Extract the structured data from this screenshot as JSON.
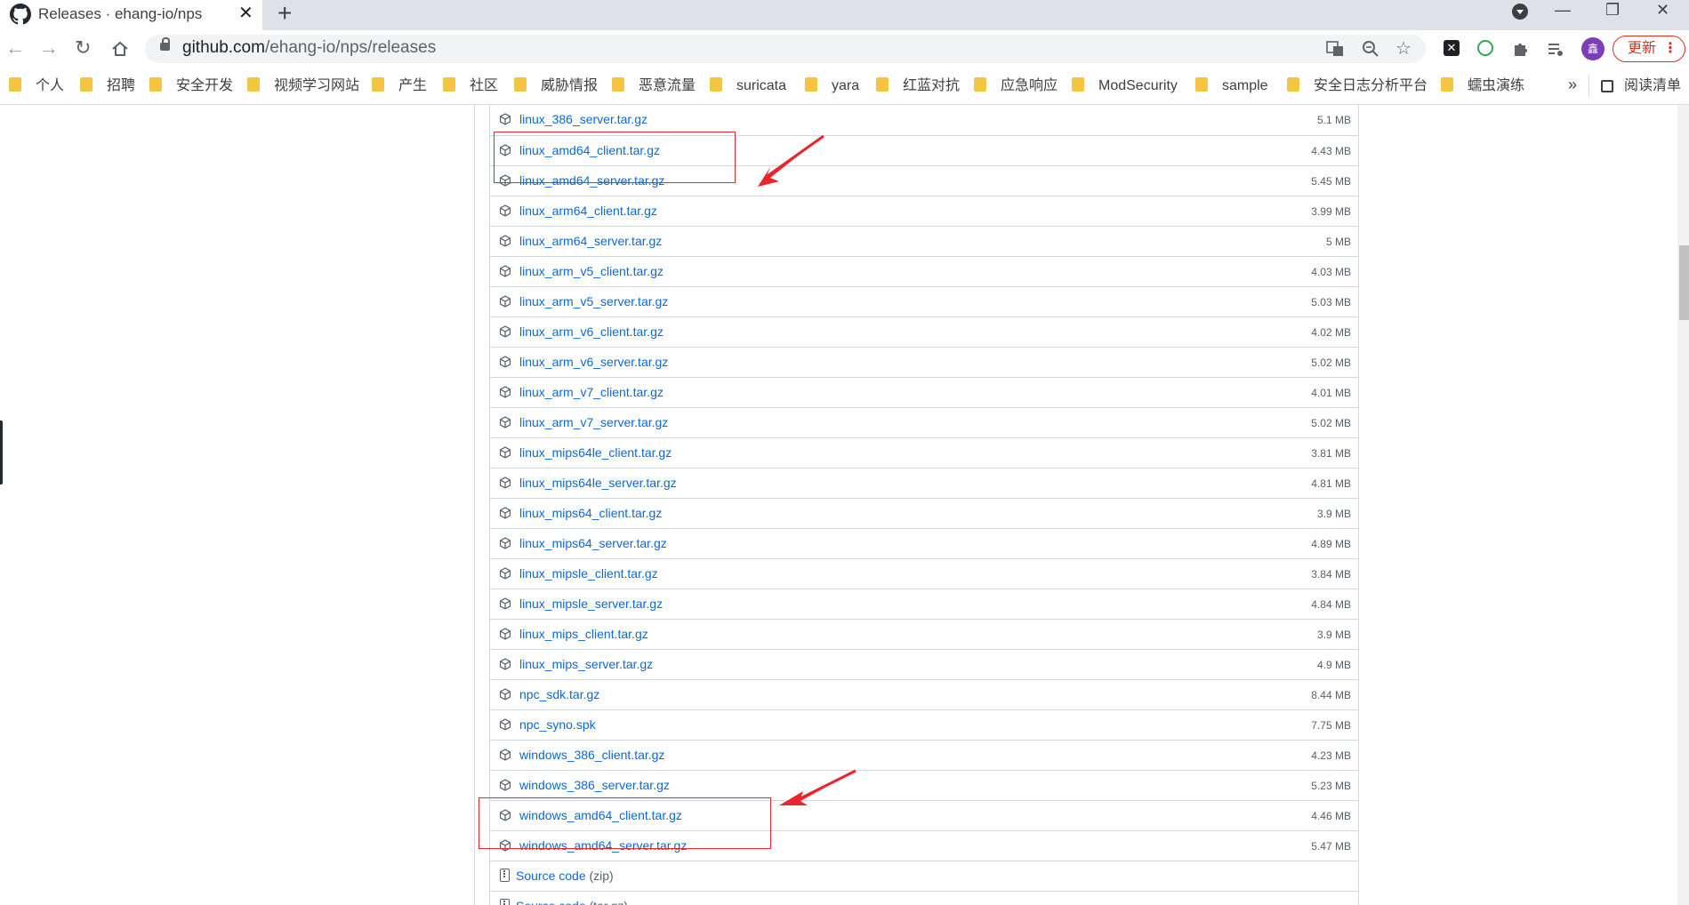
{
  "tab": {
    "title": "Releases · ehang-io/nps",
    "close_glyph": "✕",
    "new_tab_glyph": "+"
  },
  "window": {
    "minimize": "—",
    "restore": "❐",
    "close": "✕"
  },
  "address": {
    "url_host": "github.com",
    "url_path": "/ehang-io/nps/releases"
  },
  "profile": {
    "avatar_text": "鑫",
    "update_label": "更新",
    "menu_glyph": "⋮"
  },
  "bookmarks": {
    "items": [
      "个人",
      "招聘",
      "安全开发",
      "视频学习网站",
      "产生",
      "社区",
      "威胁情报",
      "恶意流量",
      "suricata",
      "yara",
      "红蓝对抗",
      "应急响应",
      "ModSecurity",
      "sample",
      "安全日志分析平台",
      "蠕虫演练"
    ],
    "more_glyph": "»",
    "reading_list": "阅读清单"
  },
  "assets": [
    {
      "name": "linux_386_server.tar.gz",
      "size": "5.1 MB"
    },
    {
      "name": "linux_amd64_client.tar.gz",
      "size": "4.43 MB"
    },
    {
      "name": "linux_amd64_server.tar.gz",
      "size": "5.45 MB"
    },
    {
      "name": "linux_arm64_client.tar.gz",
      "size": "3.99 MB"
    },
    {
      "name": "linux_arm64_server.tar.gz",
      "size": "5 MB"
    },
    {
      "name": "linux_arm_v5_client.tar.gz",
      "size": "4.03 MB"
    },
    {
      "name": "linux_arm_v5_server.tar.gz",
      "size": "5.03 MB"
    },
    {
      "name": "linux_arm_v6_client.tar.gz",
      "size": "4.02 MB"
    },
    {
      "name": "linux_arm_v6_server.tar.gz",
      "size": "5.02 MB"
    },
    {
      "name": "linux_arm_v7_client.tar.gz",
      "size": "4.01 MB"
    },
    {
      "name": "linux_arm_v7_server.tar.gz",
      "size": "5.02 MB"
    },
    {
      "name": "linux_mips64le_client.tar.gz",
      "size": "3.81 MB"
    },
    {
      "name": "linux_mips64le_server.tar.gz",
      "size": "4.81 MB"
    },
    {
      "name": "linux_mips64_client.tar.gz",
      "size": "3.9 MB"
    },
    {
      "name": "linux_mips64_server.tar.gz",
      "size": "4.89 MB"
    },
    {
      "name": "linux_mipsle_client.tar.gz",
      "size": "3.84 MB"
    },
    {
      "name": "linux_mipsle_server.tar.gz",
      "size": "4.84 MB"
    },
    {
      "name": "linux_mips_client.tar.gz",
      "size": "3.9 MB"
    },
    {
      "name": "linux_mips_server.tar.gz",
      "size": "4.9 MB"
    },
    {
      "name": "npc_sdk.tar.gz",
      "size": "8.44 MB"
    },
    {
      "name": "npc_syno.spk",
      "size": "7.75 MB"
    },
    {
      "name": "windows_386_client.tar.gz",
      "size": "4.23 MB"
    },
    {
      "name": "windows_386_server.tar.gz",
      "size": "5.23 MB"
    },
    {
      "name": "windows_amd64_client.tar.gz",
      "size": "4.46 MB"
    },
    {
      "name": "windows_amd64_server.tar.gz",
      "size": "5.47 MB"
    }
  ],
  "source": [
    {
      "label": "Source code",
      "ext": "(zip)"
    },
    {
      "label": "Source code",
      "ext": "(tar.gz)"
    }
  ],
  "annotation_color": "#e8262b"
}
